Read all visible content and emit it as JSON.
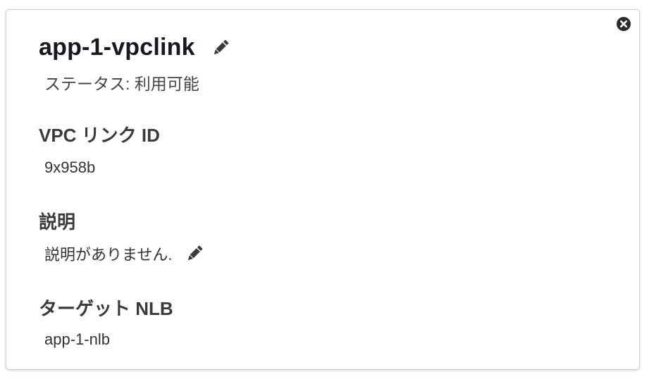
{
  "vpc_link": {
    "name": "app-1-vpclink",
    "status_text": "ステータス: 利用可能",
    "id_label": "VPC リンク ID",
    "id_value": "9x958b",
    "description_label": "説明",
    "description_value": "説明がありません.",
    "target_label": "ターゲット NLB",
    "target_value": "app-1-nlb"
  },
  "icons": {
    "close": "close-circle-icon",
    "edit": "pencil-icon"
  },
  "colors": {
    "title": "#16191f",
    "text": "#333333",
    "icon": "#3a3a3a",
    "border": "#cfcfcf"
  }
}
